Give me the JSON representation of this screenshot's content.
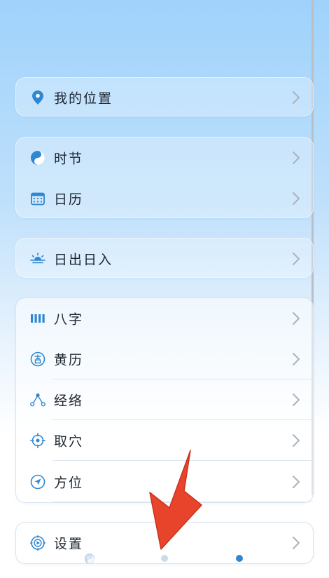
{
  "menu": {
    "location": {
      "label": "我的位置",
      "icon": "location-pin-icon"
    },
    "solar_term": {
      "label": "时节",
      "icon": "yin-yang-icon"
    },
    "calendar": {
      "label": "日历",
      "icon": "calendar-icon"
    },
    "sunrise_sunset": {
      "label": "日出日入",
      "icon": "sunrise-icon"
    },
    "bazi": {
      "label": "八字",
      "icon": "bars-icon"
    },
    "almanac": {
      "label": "黄历",
      "icon": "ji-seal-icon"
    },
    "meridian": {
      "label": "经络",
      "icon": "nodes-icon"
    },
    "acupoint": {
      "label": "取穴",
      "icon": "crosshair-icon"
    },
    "direction": {
      "label": "方位",
      "icon": "compass-icon"
    },
    "settings": {
      "label": "设置",
      "icon": "gear-icon"
    }
  },
  "colors": {
    "accent": "#2f86d1",
    "arrow": "#e8442c"
  },
  "pager": {
    "current_page": 3,
    "total_pages": 3
  }
}
